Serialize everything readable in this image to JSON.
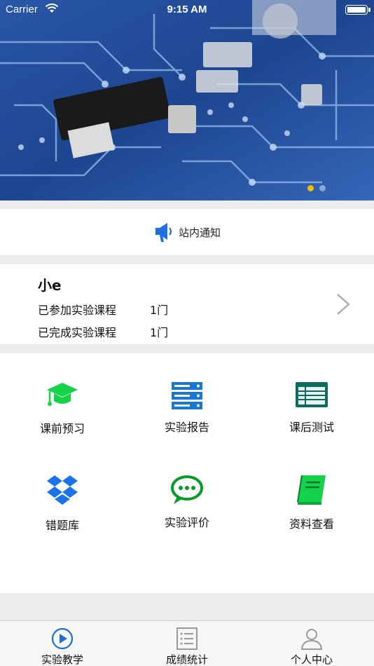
{
  "status_bar": {
    "carrier": "Carrier",
    "time": "9:15 AM",
    "wifi_icon": "wifi-icon",
    "battery_icon": "battery-icon"
  },
  "banner": {
    "image": "circuit-board-photo",
    "carousel": {
      "count": 2,
      "active_index": 0,
      "active_color": "#f0c000"
    }
  },
  "notice": {
    "label": "站内通知",
    "icon": "megaphone-icon",
    "icon_color": "#1f6fe0"
  },
  "profile": {
    "name": "小e",
    "rows": [
      {
        "label": "已参加实验课程",
        "value": "1门"
      },
      {
        "label": "已完成实验课程",
        "value": "1门"
      }
    ],
    "chevron_icon": "chevron-right-icon"
  },
  "grid": {
    "items": [
      {
        "label": "课前预习",
        "icon": "graduation-cap-icon",
        "color": "#14d24a"
      },
      {
        "label": "实验报告",
        "icon": "server-list-icon",
        "color": "#1877d6"
      },
      {
        "label": "课后测试",
        "icon": "table-sheet-icon",
        "color": "#0d6b5e"
      },
      {
        "label": "错题库",
        "icon": "dropbox-icon",
        "color": "#1a73e8"
      },
      {
        "label": "实验评价",
        "icon": "chat-bubble-icon",
        "color": "#0a9c2a"
      },
      {
        "label": "资料查看",
        "icon": "book-icon",
        "color": "#14d24a"
      }
    ]
  },
  "tabbar": {
    "tabs": [
      {
        "label": "实验教学",
        "icon": "play-circle-icon",
        "selected": true,
        "color": "#1a6fd8"
      },
      {
        "label": "成绩统计",
        "icon": "list-document-icon",
        "selected": false,
        "color": "#9a9a9a"
      },
      {
        "label": "个人中心",
        "icon": "person-icon",
        "selected": false,
        "color": "#9a9a9a"
      }
    ]
  }
}
